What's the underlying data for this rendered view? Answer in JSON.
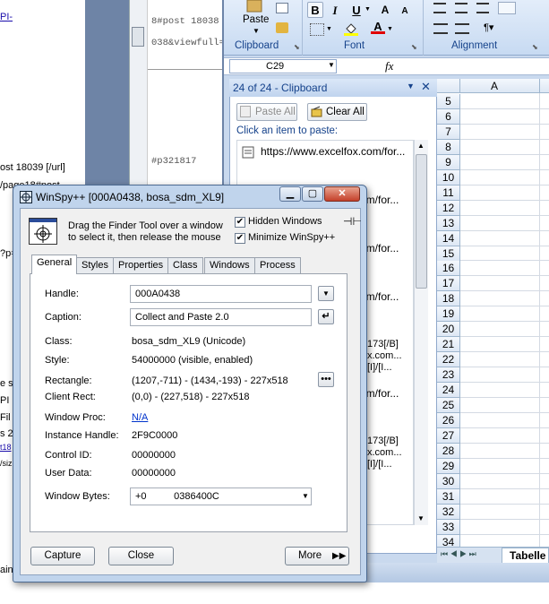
{
  "background_page": {
    "lines": [
      {
        "text": "PI-",
        "link": true
      },
      {
        "text": "ost 18039 [/url]",
        "link": false
      },
      {
        "text": "/page18#post",
        "link": false
      },
      {
        "text": "?p=",
        "link": false
      },
      {
        "text": "e s",
        "link": false
      },
      {
        "text": "PI",
        "link": false
      },
      {
        "text": "Fil",
        "link": false
      },
      {
        "text": "s 2",
        "link": false
      },
      {
        "text": "t18",
        "link": true
      },
      {
        "text": "/siz",
        "link": false
      },
      {
        "text": "ain",
        "link": false
      }
    ],
    "mid_lines": [
      "8#post 18038",
      "038&viewfull=1",
      "#p321817"
    ]
  },
  "excel": {
    "ribbon": {
      "paste_label": "Paste",
      "groups": [
        "Clipboard",
        "Font",
        "Alignment"
      ]
    },
    "name_box": "C29",
    "fx": "fx",
    "clipboard_pane": {
      "title": "24 of 24 - Clipboard",
      "paste_all": "Paste All",
      "clear_all": "Clear All",
      "hint": "Click an item to paste:",
      "items": [
        "https://www.excelfox.com/for...",
        "om/for...",
        "om/for...",
        "om/for...",
        "173[/B]",
        "x.com...",
        "[I]/[I...",
        "om/for...",
        "173[/B]",
        "x.com...",
        "[I]/[I..."
      ]
    },
    "grid": {
      "column": "A",
      "rows": [
        "5",
        "6",
        "7",
        "8",
        "9",
        "10",
        "11",
        "12",
        "13",
        "14",
        "15",
        "16",
        "17",
        "18",
        "19",
        "20",
        "21",
        "22",
        "23",
        "24",
        "25",
        "26",
        "27",
        "28",
        "29",
        "30",
        "31",
        "32",
        "33",
        "34"
      ]
    },
    "sheet_tab": "Tabelle"
  },
  "winspy": {
    "title": "WinSpy++ [000A0438, bosa_sdm_XL9]",
    "finder_text_1": "Drag the Finder Tool over a window",
    "finder_text_2": "to select it, then release the mouse",
    "hidden_windows": "Hidden Windows",
    "minimize": "Minimize WinSpy++",
    "tabs": [
      "General",
      "Styles",
      "Properties",
      "Class",
      "Windows",
      "Process"
    ],
    "fields": {
      "handle_label": "Handle:",
      "handle_value": "000A0438",
      "caption_label": "Caption:",
      "caption_value": "Collect and Paste 2.0",
      "class_label": "Class:",
      "class_value": "bosa_sdm_XL9  (Unicode)",
      "style_label": "Style:",
      "style_value": "54000000  (visible, enabled)",
      "rect_label": "Rectangle:",
      "rect_value": "(1207,-711) - (1434,-193)  -  227x518",
      "client_label": "Client Rect:",
      "client_value": "(0,0) - (227,518)  -  227x518",
      "winproc_label": "Window Proc:",
      "winproc_value": "N/A",
      "instance_label": "Instance Handle:",
      "instance_value": "2F9C0000",
      "control_label": "Control ID:",
      "control_value": "00000000",
      "userdata_label": "User Data:",
      "userdata_value": "00000000",
      "bytes_label": "Window Bytes:",
      "bytes_value": "+0          0386400C"
    },
    "buttons": {
      "capture": "Capture",
      "close": "Close",
      "more": "More"
    }
  }
}
